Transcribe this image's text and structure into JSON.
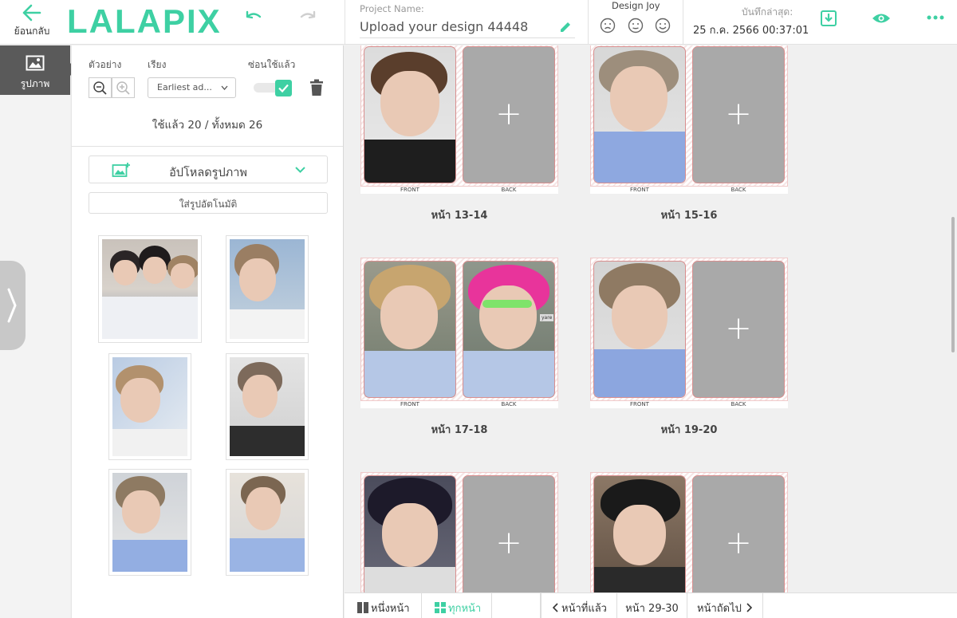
{
  "header": {
    "back_label": "ย้อนกลับ",
    "logo": "LALAPIX",
    "project_label": "Project Name:",
    "project_value": "Upload your design 44448",
    "design_joy_label": "Design Joy",
    "saved_label": "บันทึกล่าสุด:",
    "saved_time": "25 ก.ค. 2566 00:37:01",
    "icons": [
      "back-arrow-icon",
      "undo-icon",
      "redo-icon",
      "pencil-icon",
      "sad-face-icon",
      "neutral-face-icon",
      "happy-face-icon",
      "download-icon",
      "eye-icon",
      "more-icon"
    ],
    "accent_color": "#3ed0a3"
  },
  "sidebar": {
    "tab_label": "รูปภาพ"
  },
  "panel": {
    "preview_label": "ตัวอย่าง",
    "sort_label": "เรียง",
    "sort_value": "Earliest ad...",
    "hide_used_label": "ซ่อนใช้แล้ว",
    "hide_used_checked": true,
    "count_text": "ใช้แล้ว 20 / ทั้งหมด 26",
    "upload_label": "อัปโหลดรูปภาพ",
    "auto_fill_label": "ใส่รูปอัตโนมัติ"
  },
  "canvas": {
    "front_label": "FRONT",
    "back_label": "BACK",
    "spreads": [
      {
        "label": "หน้า 13-14",
        "front": "photo",
        "back": "empty"
      },
      {
        "label": "หน้า 15-16",
        "front": "photo",
        "back": "empty"
      },
      {
        "label": "หน้า 17-18",
        "front": "photo",
        "back": "photo"
      },
      {
        "label": "หน้า 19-20",
        "front": "photo",
        "back": "empty"
      },
      {
        "label": "",
        "front": "photo",
        "back": "empty"
      },
      {
        "label": "",
        "front": "photo",
        "back": "empty"
      }
    ],
    "photo_tag": "yare"
  },
  "footer": {
    "single_page_label": "หนึ่งหน้า",
    "all_pages_label": "ทุกหน้า",
    "prev_label": "หน้าที่แล้ว",
    "page_range": "หน้า 29-30",
    "next_label": "หน้าถัดไป"
  }
}
